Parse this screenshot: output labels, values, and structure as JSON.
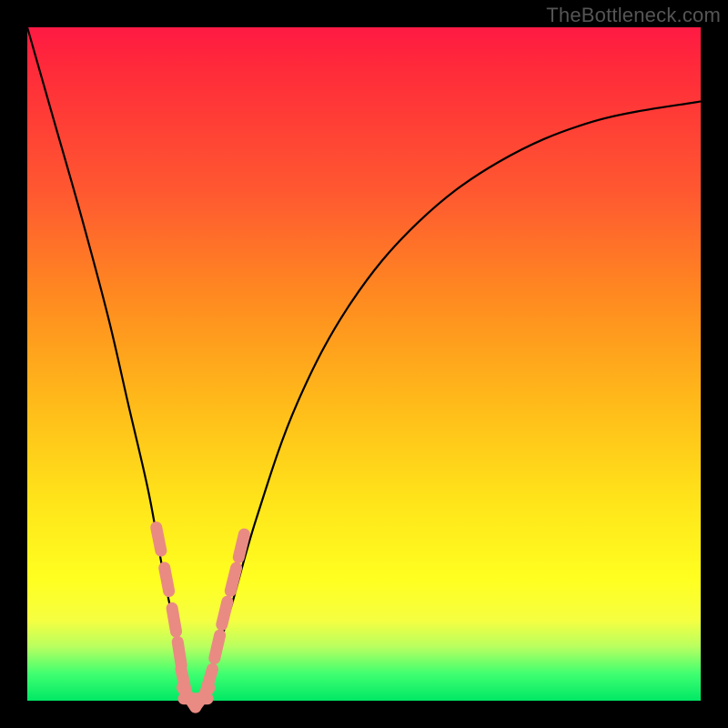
{
  "watermark": "TheBottleneck.com",
  "chart_data": {
    "type": "line",
    "title": "",
    "xlabel": "",
    "ylabel": "",
    "xlim": [
      0,
      100
    ],
    "ylim": [
      0,
      100
    ],
    "series": [
      {
        "name": "bottleneck-curve",
        "x": [
          0,
          4,
          8,
          12,
          15,
          18,
          20,
          22,
          23.5,
          25,
          27,
          30,
          34,
          40,
          48,
          58,
          70,
          84,
          100
        ],
        "y": [
          100,
          86,
          72,
          57,
          44,
          31,
          20,
          10,
          2,
          0,
          4,
          13,
          27,
          44,
          59,
          71,
          80,
          86,
          89
        ]
      }
    ],
    "markers": [
      {
        "name": "highlight-dashes",
        "points": [
          {
            "x": 19.5,
            "y": 24
          },
          {
            "x": 20.7,
            "y": 18
          },
          {
            "x": 21.8,
            "y": 12
          },
          {
            "x": 22.6,
            "y": 7
          },
          {
            "x": 23.2,
            "y": 3
          },
          {
            "x": 24.0,
            "y": 0.5
          },
          {
            "x": 25.0,
            "y": 0.3
          },
          {
            "x": 26.0,
            "y": 0.5
          },
          {
            "x": 27.0,
            "y": 3
          },
          {
            "x": 28.2,
            "y": 8
          },
          {
            "x": 29.3,
            "y": 13
          },
          {
            "x": 30.6,
            "y": 18
          },
          {
            "x": 31.8,
            "y": 23
          }
        ]
      }
    ],
    "colors": {
      "curve": "#000000",
      "marker": "#e98b82",
      "background_top": "#ff1a44",
      "background_bottom": "#00e865"
    }
  }
}
